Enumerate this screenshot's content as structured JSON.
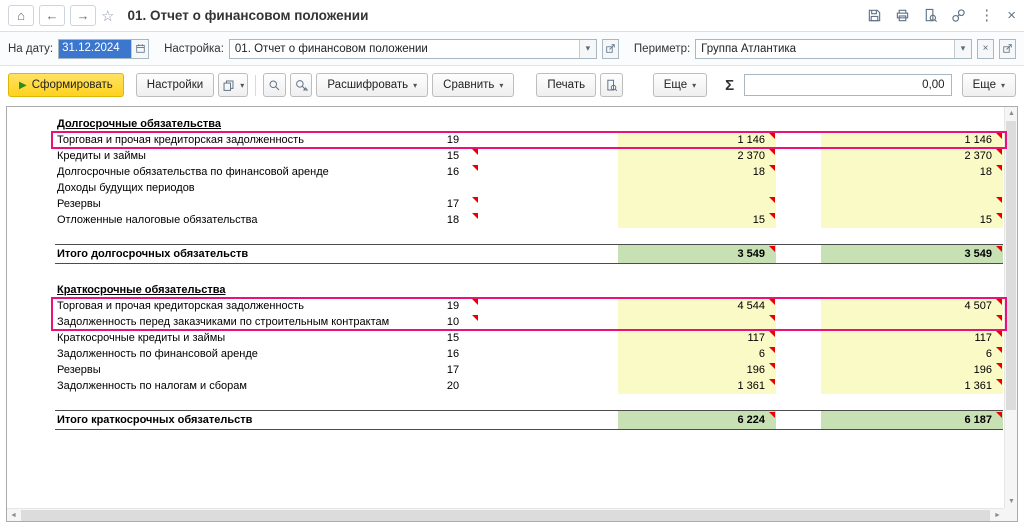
{
  "titlebar": {
    "title": "01. Отчет о финансовом положении"
  },
  "icons": {
    "home": "⌂",
    "back": "←",
    "forward": "→",
    "favorite": "☆",
    "menu": "⋮",
    "close": "×",
    "dropdown": "▾",
    "play": "▶",
    "clear": "×",
    "scroll_up": "▲",
    "scroll_down": "▼",
    "scroll_left": "◄",
    "scroll_right": "►"
  },
  "filters": {
    "date": {
      "label": "На дату:",
      "value": "31.12.2024"
    },
    "setting": {
      "label": "Настройка:",
      "value": "01. Отчет о финансовом положении"
    },
    "perimeter": {
      "label": "Периметр:",
      "value": "Группа Атлантика"
    }
  },
  "toolbar": {
    "generate": "Сформировать",
    "settings": "Настройки",
    "decipher": "Расшифровать",
    "compare": "Сравнить",
    "print": "Печать",
    "more": "Еще",
    "sigma": "Σ",
    "amount": "0,00",
    "more2": "Еще"
  },
  "report": {
    "rows": [
      {
        "type": "section",
        "label": "Долгосрочные обязательства"
      },
      {
        "type": "data",
        "label": "Торговая и прочая кредиторская задолженность",
        "code": "19",
        "mtri": false,
        "v1": "1 146",
        "v2": "1 146",
        "t1": true,
        "t2": true,
        "hl": "single"
      },
      {
        "type": "data",
        "label": "Кредиты и займы",
        "code": "15",
        "mtri": true,
        "v1": "2 370",
        "v2": "2 370",
        "t1": true,
        "t2": true
      },
      {
        "type": "data",
        "label": "Долгосрочные обязательства по финансовой аренде",
        "code": "16",
        "mtri": true,
        "v1": "18",
        "v2": "18",
        "t1": true,
        "t2": true
      },
      {
        "type": "data",
        "label": "Доходы будущих периодов",
        "code": "",
        "mtri": false,
        "v1": "",
        "v2": "",
        "t1": false,
        "t2": false
      },
      {
        "type": "data",
        "label": "Резервы",
        "code": "17",
        "mtri": true,
        "v1": "",
        "v2": "",
        "t1": true,
        "t2": true
      },
      {
        "type": "data",
        "label": "Отложенные налоговые обязательства",
        "code": "18",
        "mtri": true,
        "v1": "15",
        "v2": "15",
        "t1": true,
        "t2": true
      },
      {
        "type": "spacer",
        "h": 16
      },
      {
        "type": "total",
        "label": "Итого долгосрочных обязательств",
        "v1": "3 549",
        "v2": "3 549",
        "t1": true,
        "t2": true
      },
      {
        "type": "spacer",
        "h": 18
      },
      {
        "type": "section",
        "label": "Краткосрочные обязательства"
      },
      {
        "type": "data",
        "label": "Торговая и прочая кредиторская задолженность",
        "code": "19",
        "mtri": true,
        "v1": "4 544",
        "v2": "4 507",
        "t1": true,
        "t2": true,
        "hl": "top"
      },
      {
        "type": "data",
        "label": "Задолженность перед заказчиками по строительным контрактам",
        "code": "10",
        "mtri": true,
        "v1": "",
        "v2": "",
        "t1": true,
        "t2": true,
        "hl": "bottom"
      },
      {
        "type": "data",
        "label": "Краткосрочные кредиты и займы",
        "code": "15",
        "mtri": false,
        "v1": "117",
        "v2": "117",
        "t1": true,
        "t2": true
      },
      {
        "type": "data",
        "label": "Задолженность по финансовой аренде",
        "code": "16",
        "mtri": false,
        "v1": "6",
        "v2": "6",
        "t1": true,
        "t2": true
      },
      {
        "type": "data",
        "label": "Резервы",
        "code": "17",
        "mtri": false,
        "v1": "196",
        "v2": "196",
        "t1": true,
        "t2": true
      },
      {
        "type": "data",
        "label": "Задолженность по налогам и сборам",
        "code": "20",
        "mtri": false,
        "v1": "1 361",
        "v2": "1 361",
        "t1": true,
        "t2": true
      },
      {
        "type": "spacer",
        "h": 16
      },
      {
        "type": "total",
        "label": "Итого краткосрочных обязательств",
        "v1": "6 224",
        "v2": "6 187",
        "t1": true,
        "t2": true
      }
    ]
  },
  "colors": {
    "highlight_pink": "#ea1178",
    "cell_yellow": "#fafac6",
    "total_green": "#c7e0b4",
    "note_red": "#e80000",
    "generate_yellow": "#ffd21d",
    "selection_blue": "#3c77cf"
  }
}
